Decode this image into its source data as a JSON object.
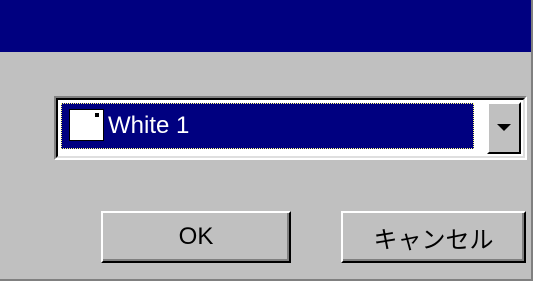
{
  "window": {
    "title": ""
  },
  "color_combo": {
    "selected_label": "White 1",
    "selected_swatch_color": "#ffffff",
    "dropdown_icon": "chevron-down-icon"
  },
  "buttons": {
    "ok_label": "OK",
    "cancel_label": "キャンセル"
  },
  "colors": {
    "titlebar": "#000080",
    "dialog_face": "#c0c0c0",
    "selection": "#000080"
  }
}
